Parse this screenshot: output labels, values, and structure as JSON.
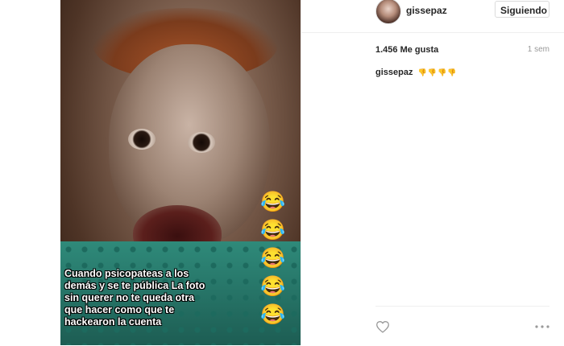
{
  "post": {
    "image": {
      "caption_overlay": "Cuando psicopateas a los\ndemás y se te pública La foto\nsin querer no te queda otra\nque hacer como que te\nhackearon la cuenta",
      "emojis": [
        "😂",
        "😂",
        "😂",
        "😂",
        "😂"
      ]
    },
    "header": {
      "username": "gissepaz",
      "follow_label": "Siguiendo"
    },
    "likes_text": "1.456 Me gusta",
    "timestamp": "1 sem",
    "comment": {
      "username": "gissepaz",
      "text": "👎👎👎👎"
    },
    "actions": {
      "like_icon": "heart-outline-icon",
      "more_icon": "more-options-icon"
    }
  },
  "colors": {
    "border": "#efefef",
    "text": "#262626",
    "muted": "#999999"
  }
}
